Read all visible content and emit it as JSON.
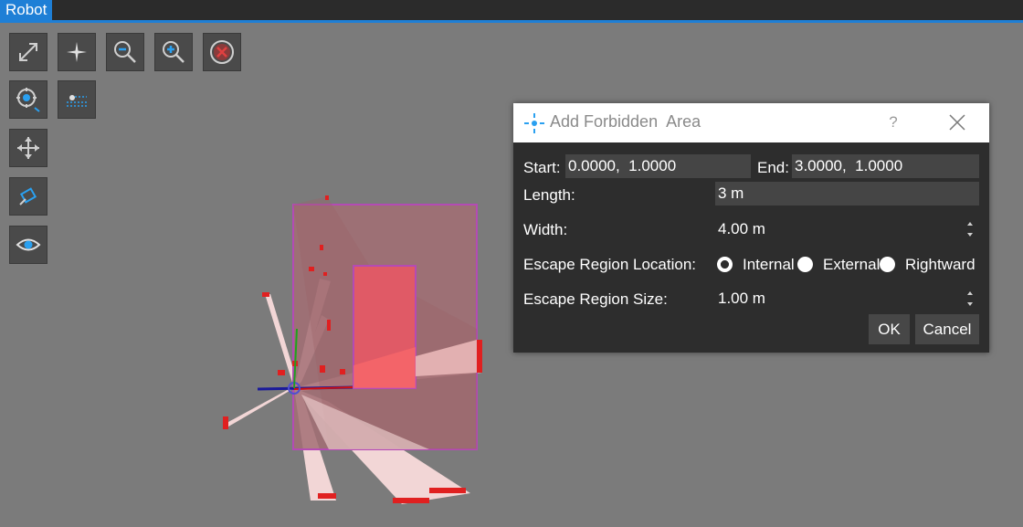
{
  "topbar": {
    "tab_label": "Robot"
  },
  "toolbar": {
    "icons": [
      "expand-icon",
      "center-star-icon",
      "zoom-out-icon",
      "zoom-in-icon",
      "clear-icon",
      "locate-icon",
      "lidar-icon",
      "move-icon",
      "camera-icon",
      "eye-icon"
    ]
  },
  "dialog": {
    "title": "Add Forbidden  Area",
    "help": "?",
    "start_label": "Start:",
    "start_value": "0.0000,  1.0000",
    "end_label": "End:",
    "end_value": "3.0000,  1.0000",
    "length_label": "Length:",
    "length_value": "3 m",
    "width_label": "Width:",
    "width_value": "4.00 m",
    "escape_location_label": "Escape Region Location:",
    "option_internal": "Internal",
    "option_external": "External",
    "option_rightward": "Rightward",
    "escape_size_label": "Escape Region Size:",
    "escape_size_value": "1.00 m",
    "ok_label": "OK",
    "cancel_label": "Cancel",
    "colors": {
      "accent": "#1e7fd6",
      "dialog_bg": "#2d2d2d",
      "field_bg": "#454545"
    }
  }
}
